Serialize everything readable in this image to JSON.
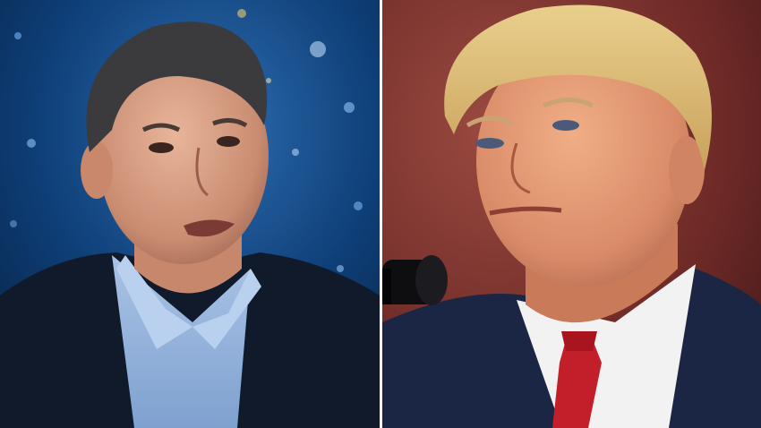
{
  "image": {
    "panels": [
      {
        "subject": "man-in-dark-blazer-speaking",
        "background_color": "#0b3a6e",
        "accent_color": "#6fa8dc"
      },
      {
        "subject": "man-with-blonde-hair-red-tie",
        "background_color": "#7a2e2a",
        "accent_color": "#c21f2a"
      }
    ],
    "divider_color": "#f4f4f4"
  }
}
